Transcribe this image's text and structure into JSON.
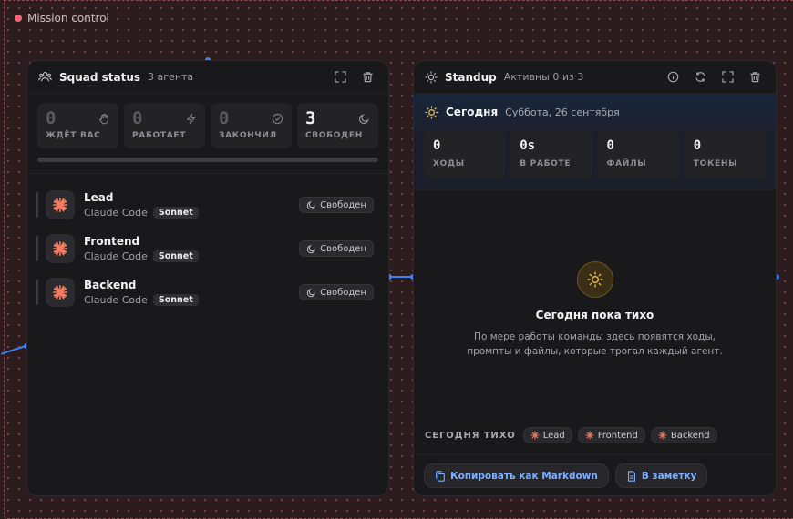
{
  "canvas": {
    "label": "Mission control"
  },
  "colors": {
    "accent": "#3b82f6",
    "link": "#7db0ff",
    "agent_icon": "#f07d62",
    "sun": "#e5b54a",
    "frame": "#f06a72"
  },
  "squad": {
    "title": "Squad status",
    "subtitle": "3 агента",
    "stats": [
      {
        "value": "0",
        "label": "ЖДЁТ ВАС",
        "icon": "hand-icon"
      },
      {
        "value": "0",
        "label": "РАБОТАЕТ",
        "icon": "bolt-icon"
      },
      {
        "value": "0",
        "label": "ЗАКОНЧИЛ",
        "icon": "check-circle-icon"
      },
      {
        "value": "3",
        "label": "СВОБОДЕН",
        "icon": "moon-icon"
      }
    ],
    "progress": 0,
    "agents": [
      {
        "name": "Lead",
        "runtime": "Claude Code",
        "model": "Sonnet",
        "status": "Свободен"
      },
      {
        "name": "Frontend",
        "runtime": "Claude Code",
        "model": "Sonnet",
        "status": "Свободен"
      },
      {
        "name": "Backend",
        "runtime": "Claude Code",
        "model": "Sonnet",
        "status": "Свободен"
      }
    ]
  },
  "standup": {
    "title": "Standup",
    "subtitle": "Активны 0 из 3",
    "today_label": "Сегодня",
    "date": "Суббота, 26 сентября",
    "stats": [
      {
        "value": "0",
        "label": "ХОДЫ"
      },
      {
        "value": "0s",
        "label": "В РАБОТЕ"
      },
      {
        "value": "0",
        "label": "ФАЙЛЫ"
      },
      {
        "value": "0",
        "label": "ТОКЕНЫ"
      }
    ],
    "empty_title": "Сегодня пока тихо",
    "empty_desc": "По мере работы команды здесь появятся ходы, промпты и файлы, которые трогал каждый агент.",
    "quiet_label": "СЕГОДНЯ ТИХО",
    "quiet_agents": [
      "Lead",
      "Frontend",
      "Backend"
    ],
    "copy_button": "Копировать как Markdown",
    "note_button": "В заметку"
  }
}
